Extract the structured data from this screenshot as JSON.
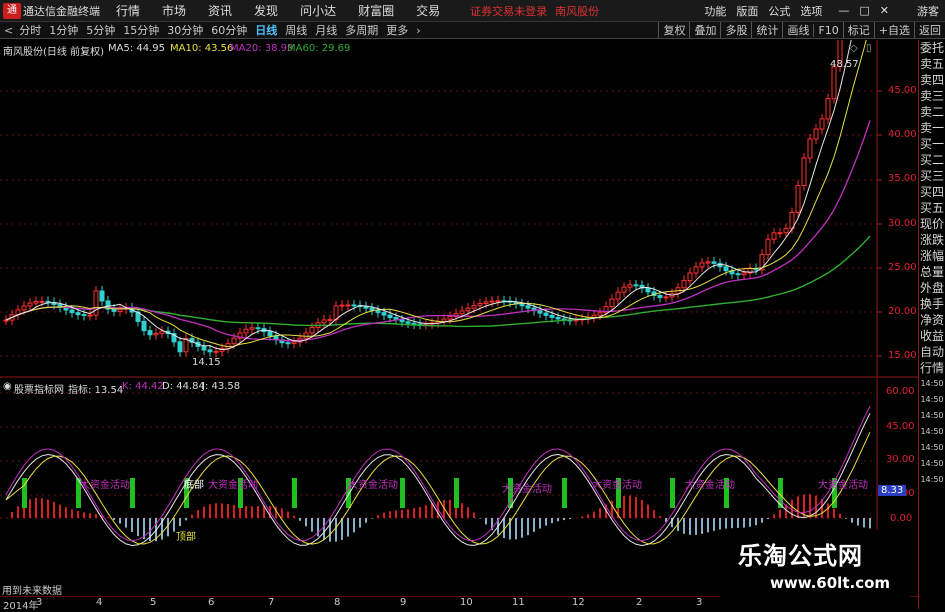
{
  "app": {
    "title": "通达信金融终端",
    "logo": "通"
  },
  "menu": [
    "行情",
    "市场",
    "资讯",
    "发现",
    "问小达",
    "财富圈",
    "交易"
  ],
  "warning": "证券交易未登录",
  "stock_name_top": "南风股份",
  "right_menu": [
    "功能",
    "版面",
    "公式",
    "选项"
  ],
  "guest": "游客",
  "periods": [
    "分时",
    "1分钟",
    "5分钟",
    "15分钟",
    "30分钟",
    "60分钟",
    "日线",
    "周线",
    "月线",
    "多周期",
    "更多"
  ],
  "active_period": "日线",
  "right_tools": [
    "复权",
    "叠加",
    "多股",
    "统计",
    "画线",
    "F10",
    "标记",
    "+自选",
    "返回"
  ],
  "right_panel": [
    "委托",
    "卖五",
    "卖四",
    "卖三",
    "卖二",
    "卖一",
    "买一",
    "买二",
    "买三",
    "买四",
    "买五",
    "现价",
    "涨跌",
    "涨幅",
    "总量",
    "外盘",
    "换手",
    "净资",
    "收益",
    "",
    "自动",
    "行情",
    "14:50",
    "14:50",
    "14:50",
    "14:50",
    "14:50",
    "14:50",
    "14:50"
  ],
  "main": {
    "title": "南风股份(日线 前复权)",
    "ma5": "MA5: 44.95",
    "ma10": "MA10: 43.56",
    "ma20": "MA20: 38.93",
    "ma60": "MA60: 29.69",
    "high_label": "48.57",
    "low_label": "14.15",
    "yaxis": [
      "45.00",
      "40.00",
      "35.00",
      "30.00",
      "25.00",
      "20.00",
      "15.00"
    ]
  },
  "sub": {
    "title": "股票指标网",
    "indicator": "指标: 13.54",
    "k": "K: 44.42",
    "d": "D: 44.84",
    "j": "J: 43.58",
    "yaxis": [
      "60.00",
      "45.00",
      "30.00",
      "15.00",
      "0.00"
    ],
    "current": "8.33",
    "labels": [
      "大资金活动",
      "大资金活动",
      "大资金活动",
      "大资金活动",
      "大资金活动",
      "大资金活动",
      "大资金活动",
      "底部",
      "顶部"
    ]
  },
  "footer": {
    "note": "用到未来数据",
    "year": "2014年",
    "months": [
      "3",
      "4",
      "5",
      "6",
      "7",
      "8",
      "9",
      "10",
      "11",
      "12",
      "2",
      "3"
    ]
  },
  "watermark": {
    "title": "乐淘公式网",
    "url": "www.60lt.com"
  }
}
